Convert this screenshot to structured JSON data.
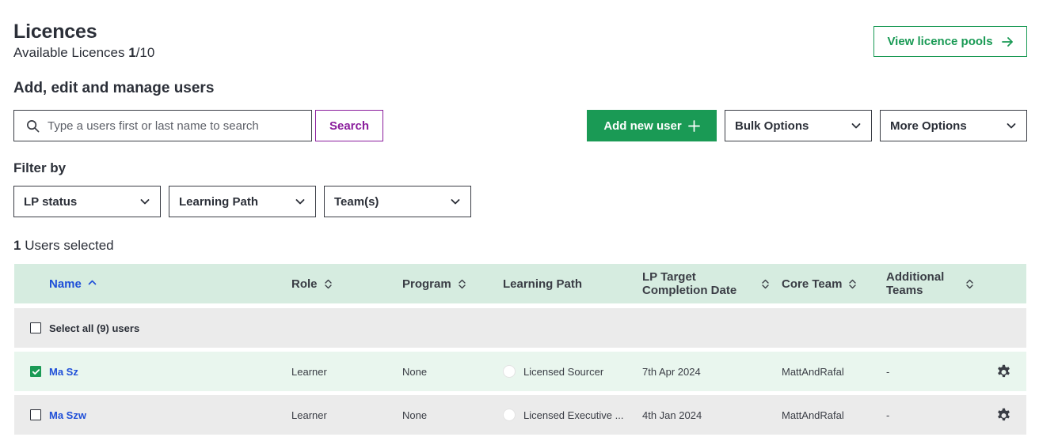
{
  "header": {
    "title": "Licences",
    "available_label": "Available Licences",
    "available_used": "1",
    "available_total": "/10",
    "view_pools_label": "View licence pools"
  },
  "manage": {
    "heading": "Add, edit and manage users",
    "search_placeholder": "Type a users first or last name to search",
    "search_value": "",
    "search_button": "Search",
    "add_user_label": "Add new user",
    "bulk_options_label": "Bulk Options",
    "more_options_label": "More Options"
  },
  "filters": {
    "label": "Filter by",
    "lp_status": "LP status",
    "learning_path": "Learning Path",
    "teams": "Team(s)"
  },
  "selection": {
    "count": "1",
    "label": "Users selected"
  },
  "table": {
    "columns": {
      "name": "Name",
      "role": "Role",
      "program": "Program",
      "learning_path": "Learning Path",
      "lp_target_line1": "LP Target",
      "lp_target_line2": "Completion Date",
      "core_team": "Core Team",
      "additional_teams_line1": "Additional",
      "additional_teams_line2": "Teams"
    },
    "select_all_label": "Select all (9) users",
    "rows": [
      {
        "checked": true,
        "name": "Ma Sz",
        "role": "Learner",
        "program": "None",
        "learning_path": "Licensed Sourcer",
        "target_date": "7th Apr 2024",
        "core_team": "MattAndRafal",
        "additional_teams": "-"
      },
      {
        "checked": false,
        "name": "Ma Szw",
        "role": "Learner",
        "program": "None",
        "learning_path": "Licensed Executive ...",
        "target_date": "4th Jan 2024",
        "core_team": "MattAndRafal",
        "additional_teams": "-"
      }
    ]
  },
  "colors": {
    "brand_green": "#1a9a55",
    "search_purple": "#8a1c9c",
    "link_blue": "#1f4fd8",
    "header_row_bg": "#d6ece0",
    "selected_row_bg": "#e9f6ee",
    "row_bg": "#ebebeb"
  },
  "icons": {
    "pools_button": "arrow-right-icon",
    "search": "search-icon",
    "add_user": "plus-icon",
    "dropdowns": "chevron-down-icon",
    "sort_active": "chevron-up-icon",
    "sort": "sort-updown-icon",
    "row_action": "gear-icon",
    "checked": "checkmark-icon"
  }
}
